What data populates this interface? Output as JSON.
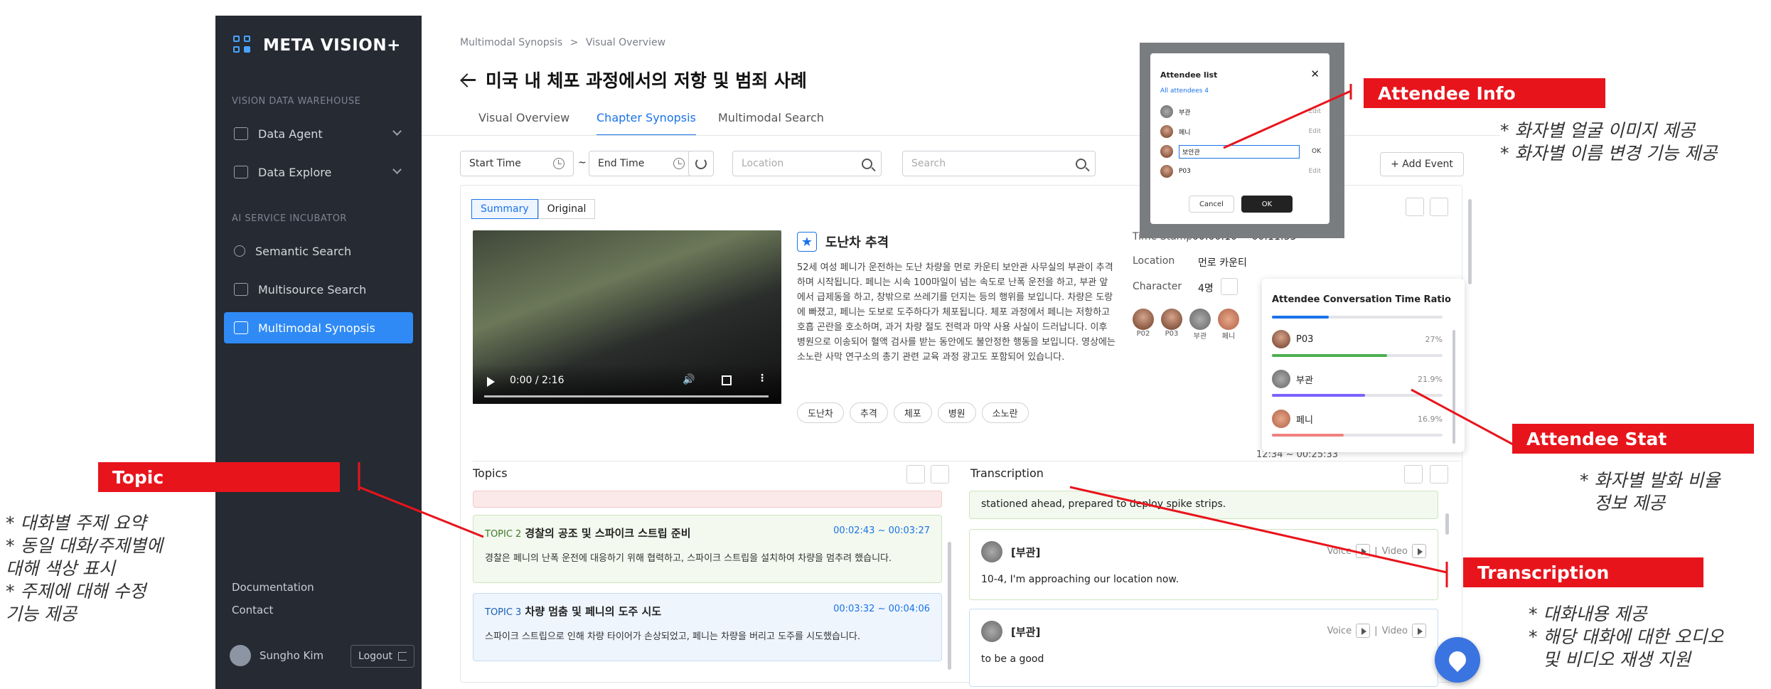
{
  "sidebar": {
    "logo": "META VISION+",
    "section1": "VISION DATA WAREHOUSE",
    "section2": "AI SERVICE INCUBATOR",
    "items": [
      {
        "label": "Data Agent"
      },
      {
        "label": "Data Explore"
      },
      {
        "label": "Semantic Search"
      },
      {
        "label": "Multisource Search"
      },
      {
        "label": "Multimodal Synopsis"
      }
    ],
    "documentation": "Documentation",
    "contact": "Contact",
    "user": "Sungho Kim",
    "logout": "Logout"
  },
  "header": {
    "breadcrumb1": "Multimodal Synopsis",
    "breadcrumb_sep": ">",
    "breadcrumb2": "Visual Overview",
    "title": "미국 내 체포 과정에서의 저항 및 범죄 사례",
    "tabs": [
      "Visual Overview",
      "Chapter Synopsis",
      "Multimodal Search"
    ]
  },
  "filters": {
    "start": "Start Time",
    "tilde": "~",
    "end": "End Time",
    "location": "Location",
    "search": "Search",
    "add_event": "+ Add Event"
  },
  "view_toggle": {
    "summary": "Summary",
    "original": "Original"
  },
  "video": {
    "time": "0:00 / 2:16"
  },
  "scene": {
    "title": "도난차 추격",
    "description": "52세 여성 페니가 운전하는 도난 차량을 먼로 카운티 보안관 사무실의 부관이 추격하며 시작됩니다. 페니는 시속 100마일이 넘는 속도로 난폭 운전을 하고, 부관 앞에서 급제동을 하고, 창밖으로 쓰레기를 던지는 등의 행위를 보입니다. 차량은 도랑에 빠졌고, 페니는 도보로 도주하다가 체포됩니다. 체포 과정에서 페니는 저항하고 호흡 곤란을 호소하며, 과거 차량 절도 전력과 마약 사용 사실이 드러납니다. 이후 병원으로 이송되어 혈액 검사를 받는 동안에도 불안정한 행동을 보입니다. 영상에는 소노란 사막 연구소의 총기 관련 교육 과정 광고도 포함되어 있습니다.",
    "tags": [
      "도난차",
      "추격",
      "체포",
      "병원",
      "소노란"
    ],
    "time_stamp_label": "Time Stamp",
    "time_stamp_value": "00:00:10 ~ 00:11:53",
    "location_label": "Location",
    "location_value": "먼로 카운티",
    "character_label": "Character",
    "character_value": "4명",
    "characters": [
      "P02",
      "P03",
      "부관",
      "페니"
    ],
    "range": "12:34 ~ 00:25:33"
  },
  "topics": {
    "header": "Topics",
    "items": [
      {
        "num": "TOPIC 2",
        "title": "경찰의 공조 및 스파이크 스트립 준비",
        "time": "00:02:43 ~ 00:03:27",
        "desc": "경찰은 페니의 난폭 운전에 대응하기 위해 협력하고, 스파이크 스트립을 설치하여 차량을 멈추려 했습니다."
      },
      {
        "num": "TOPIC 3",
        "title": "차량 멈춤 및 페니의 도주 시도",
        "time": "00:03:32 ~ 00:04:06",
        "desc": "스파이크 스트립으로 인해 차량 타이어가 손상되었고, 페니는 차량을 버리고 도주를 시도했습니다."
      }
    ]
  },
  "transcription": {
    "header": "Transcription",
    "partial": "stationed ahead, prepared to deploy spike strips.",
    "voice": "Voice",
    "video": "Video",
    "items": [
      {
        "speaker": "[부관]",
        "text": "10-4, I'm approaching our location now."
      },
      {
        "speaker": "[부관]",
        "text": "to be a good"
      }
    ]
  },
  "modal": {
    "title": "Attendee list",
    "all": "All attendees",
    "count": "4",
    "rows": [
      {
        "name": "부관",
        "action": "Edit"
      },
      {
        "name": "페니",
        "action": "Edit"
      },
      {
        "name": "보안관",
        "action": "OK"
      },
      {
        "name": "P03",
        "action": "Edit"
      }
    ],
    "cancel": "Cancel",
    "ok": "OK"
  },
  "stats": {
    "title": "Attendee Conversation Time Ratio",
    "rows": [
      {
        "name": "P03",
        "pct": "27%",
        "ratio": 0.27,
        "color": "#4caf50"
      },
      {
        "name": "부관",
        "pct": "21.9%",
        "ratio": 0.219,
        "color": "#7b61ff"
      },
      {
        "name": "페니",
        "pct": "16.9%",
        "ratio": 0.169,
        "color": "#f08080"
      }
    ]
  },
  "annotations": {
    "attendee_info": "Attendee Info",
    "attendee_info_notes": [
      "* 화자별 얼굴 이미지 제공",
      "* 화자별 이름 변경 기능 제공"
    ],
    "attendee_stat": "Attendee Stat",
    "attendee_stat_notes": [
      "* 화자별 발화 비율",
      "정보 제공"
    ],
    "topic": "Topic",
    "topic_notes": [
      "* 대화별 주제 요약",
      "* 동일 대화/주제별에",
      "대해 색상 표시",
      "* 주제에 대해 수정",
      "기능 제공"
    ],
    "transcription": "Transcription",
    "transcription_notes": [
      "* 대화내용 제공",
      "* 해당 대화에 대한 오디오",
      "및 비디오 재생 지원"
    ]
  }
}
